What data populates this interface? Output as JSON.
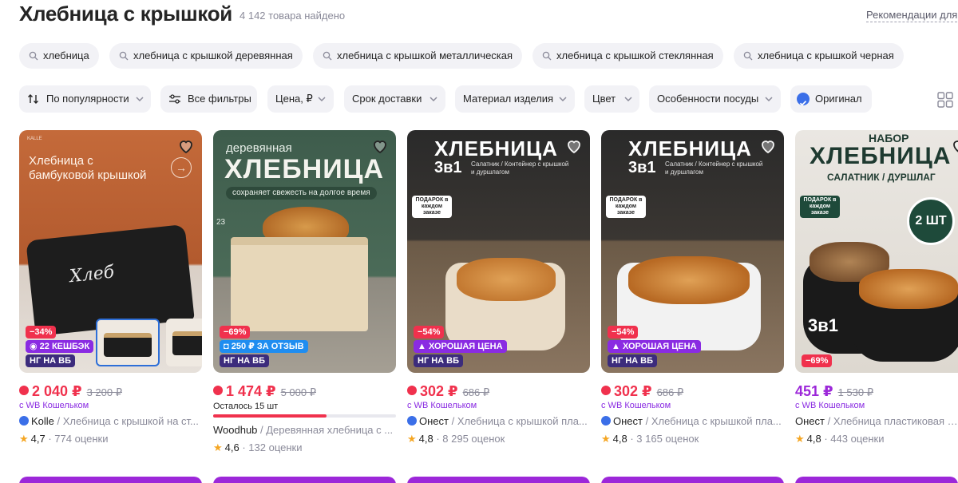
{
  "page": {
    "title": "Хлебница с крышкой",
    "count": "4 142 товара найдено",
    "recommend": "Рекомендации для"
  },
  "chips": [
    "хлебница",
    "хлебница с крышкой деревянная",
    "хлебница с крышкой металлическая",
    "хлебница с крышкой стеклянная",
    "хлебница с крышкой черная"
  ],
  "filters": {
    "sort": "По популярности",
    "all": "Все фильтры",
    "price": "Цена, ₽",
    "delivery": "Срок доставки",
    "material": "Материал изделия",
    "color": "Цвет",
    "features": "Особенности посуды",
    "original": "Оригинал"
  },
  "colors": {
    "accent": "#9c27d9",
    "discount": "#f0314d",
    "wb_badge": "#3c2c7c",
    "star": "#f5a623"
  },
  "products": [
    {
      "img_lines": [
        "Хлебница с",
        "бамбуковой крышкой",
        "KALLE",
        "Хлеб"
      ],
      "discount": "−34%",
      "promo": "22 КЕШБЭК",
      "wb": "НГ НА ВБ",
      "price": "2 040 ₽",
      "old": "3 200 ₽",
      "wallet": "с WB Кошельком",
      "brand": "Kolle",
      "name": " / Хлебница с крышкой на ст...",
      "rating": "4,7",
      "reviews": " · 774 оценки"
    },
    {
      "img_lines": [
        "деревянная",
        "ХЛЕБНИЦА",
        "сохраняет свежесть на долгое время",
        "23"
      ],
      "discount": "−69%",
      "promo": "250 ₽ ЗА ОТЗЫВ",
      "wb": "НГ НА ВБ",
      "price": "1 474 ₽",
      "old": "5 000 ₽",
      "left_text": "Осталось 15 шт",
      "left_fraction": 0.62,
      "brand": "Woodhub",
      "name": " / Деревянная хлебница с ...",
      "rating": "4,6",
      "reviews": " · 132 оценки"
    },
    {
      "img_lines": [
        "ХЛЕБНИЦА",
        "3в1",
        "Салатник / Контейнер с крышкой и дуршлагом",
        "ПОДАРОК в каждом заказе"
      ],
      "discount": "−54%",
      "promo": "ХОРОШАЯ ЦЕНА",
      "wb": "НГ НА ВБ",
      "price": "302 ₽",
      "old": "686 ₽",
      "wallet": "с WB Кошельком",
      "brand": "Онест",
      "name": " / Хлебница с крышкой пла...",
      "rating": "4,8",
      "reviews": " · 8 295 оценок"
    },
    {
      "img_lines": [
        "ХЛЕБНИЦА",
        "3в1",
        "Салатник / Контейнер с крышкой и дуршлагом",
        "ПОДАРОК в каждом заказе"
      ],
      "discount": "−54%",
      "promo": "ХОРОШАЯ ЦЕНА",
      "wb": "НГ НА ВБ",
      "price": "302 ₽",
      "old": "686 ₽",
      "wallet": "с WB Кошельком",
      "brand": "Онест",
      "name": " / Хлебница с крышкой пла...",
      "rating": "4,8",
      "reviews": " · 3 165 оценок"
    },
    {
      "img_lines": [
        "НАБОР",
        "ХЛЕБНИЦА",
        "САЛАТНИК / ДУРШЛАГ",
        "2 ШТ",
        "3в1",
        "ПОДАРОК в каждом заказе"
      ],
      "discount": "−69%",
      "price": "451 ₽",
      "old": "1 530 ₽",
      "wallet": "с WB Кошельком",
      "brand": "Онест",
      "name": " / Хлебница пластиковая с ...",
      "rating": "4,8",
      "reviews": " · 443 оценки"
    }
  ]
}
